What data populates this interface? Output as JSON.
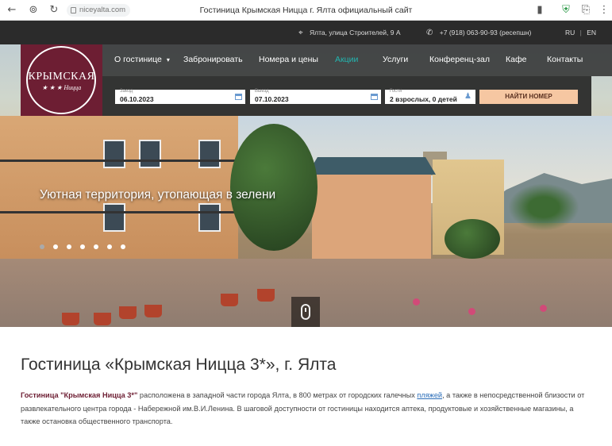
{
  "browser": {
    "url": "niceyalta.com",
    "tab_title": "Гостиница Крымская Ницца г. Ялта официальный сайт"
  },
  "topbar": {
    "address": "Ялта, улица Строителей, 9 А",
    "phone": "+7 (918) 063-90-93 (ресепшн)",
    "lang_ru": "RU",
    "lang_sep": "|",
    "lang_en": "EN"
  },
  "logo": {
    "title": "КРЫМСКАЯ",
    "subtitle": "★ ★ ★   Ницца"
  },
  "nav": {
    "items": [
      {
        "label": "О гостинице"
      },
      {
        "label": "Забронировать"
      },
      {
        "label": "Номера и цены"
      },
      {
        "label": "Акции"
      },
      {
        "label": "Услуги"
      },
      {
        "label": "Конференц-зал"
      },
      {
        "label": "Кафе"
      },
      {
        "label": "Контакты"
      }
    ]
  },
  "booking": {
    "checkin_label": "Заезд",
    "checkin_value": "06.10.2023",
    "checkout_label": "Выезд",
    "checkout_value": "07.10.2023",
    "guests_label": "Гости",
    "guests_value": "2 взрослых, 0 детей",
    "search_label": "НАЙТИ НОМЕР"
  },
  "hero": {
    "headline": "Уютная территория, утопающая в зелени"
  },
  "content": {
    "title": "Гостиница «Крымская Ницца 3*», г. Ялта",
    "hotel_name": "Гостиница \"Крымская Ницца 3*\"",
    "text_1": " расположена в западной части города Ялта, в 800 метрах от городских галечных ",
    "link": "пляжей",
    "text_2": ", а также в непосредственной близости от развлекательного центра города - Набережной им.В.И.Ленина. В шаговой доступности от гостиницы находится аптека, продуктовые и хозяйственные магазины, а также остановка общественного транспорта."
  }
}
